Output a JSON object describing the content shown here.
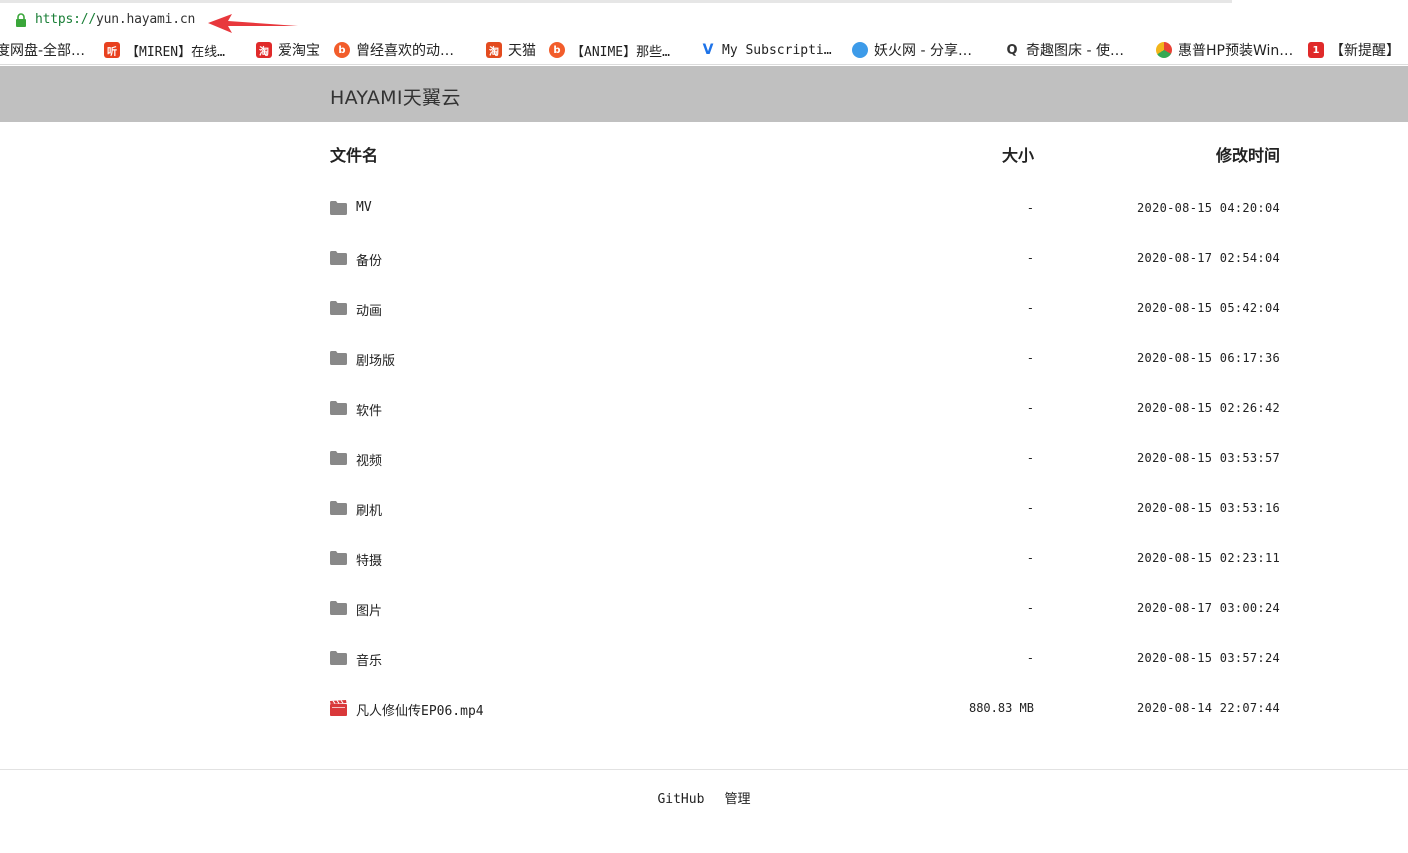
{
  "address_bar": {
    "url_protocol": "https://",
    "url_host": "yun.hayami.cn"
  },
  "bookmarks": [
    {
      "label": "度网盘-全部…",
      "icon": "none",
      "color": "#ffffff"
    },
    {
      "label": "【MIREN】在线…",
      "icon": "ting-icon",
      "color": "#e8411f"
    },
    {
      "label": "爱淘宝",
      "icon": "taobao-icon",
      "color": "#e02a2a"
    },
    {
      "label": "曾经喜欢的动…",
      "icon": "bilibili-icon",
      "color": "#f25d2b"
    },
    {
      "label": "天猫",
      "icon": "taobao-icon",
      "color": "#e34b1f"
    },
    {
      "label": "【ANIME】那些…",
      "icon": "bilibili-icon",
      "color": "#f25d2b"
    },
    {
      "label": "My Subscripti…",
      "icon": "v-icon",
      "color": "#1e73e8"
    },
    {
      "label": "妖火网 - 分享…",
      "icon": "chat-icon",
      "color": "#3d9be9"
    },
    {
      "label": "奇趣图床 - 使…",
      "icon": "q-icon",
      "color": "#333333"
    },
    {
      "label": "惠普HP预装Win…",
      "icon": "chrome-icon",
      "color": "#f2b51b"
    },
    {
      "label": "【新提醒】",
      "icon": "oneplus-icon",
      "color": "#e02a2a"
    }
  ],
  "header": {
    "title": "HAYAMI天翼云"
  },
  "table": {
    "col_name": "文件名",
    "col_size": "大小",
    "col_time": "修改时间",
    "rows": [
      {
        "type": "folder",
        "name": "MV",
        "size": "-",
        "time": "2020-08-15 04:20:04"
      },
      {
        "type": "folder",
        "name": "备份",
        "size": "-",
        "time": "2020-08-17 02:54:04"
      },
      {
        "type": "folder",
        "name": "动画",
        "size": "-",
        "time": "2020-08-15 05:42:04"
      },
      {
        "type": "folder",
        "name": "剧场版",
        "size": "-",
        "time": "2020-08-15 06:17:36"
      },
      {
        "type": "folder",
        "name": "软件",
        "size": "-",
        "time": "2020-08-15 02:26:42"
      },
      {
        "type": "folder",
        "name": "视频",
        "size": "-",
        "time": "2020-08-15 03:53:57"
      },
      {
        "type": "folder",
        "name": "刷机",
        "size": "-",
        "time": "2020-08-15 03:53:16"
      },
      {
        "type": "folder",
        "name": "特摄",
        "size": "-",
        "time": "2020-08-15 02:23:11"
      },
      {
        "type": "folder",
        "name": "图片",
        "size": "-",
        "time": "2020-08-17 03:00:24"
      },
      {
        "type": "folder",
        "name": "音乐",
        "size": "-",
        "time": "2020-08-15 03:57:24"
      },
      {
        "type": "video",
        "name": "凡人修仙传EP06.mp4",
        "size": "880.83 MB",
        "time": "2020-08-14 22:07:44"
      }
    ]
  },
  "footer": {
    "github": "GitHub",
    "admin": "管理"
  },
  "colors": {
    "header_band": "#c0c0c0",
    "folder_icon": "#888888",
    "video_icon": "#d9383a",
    "arrow": "#e8383d"
  }
}
